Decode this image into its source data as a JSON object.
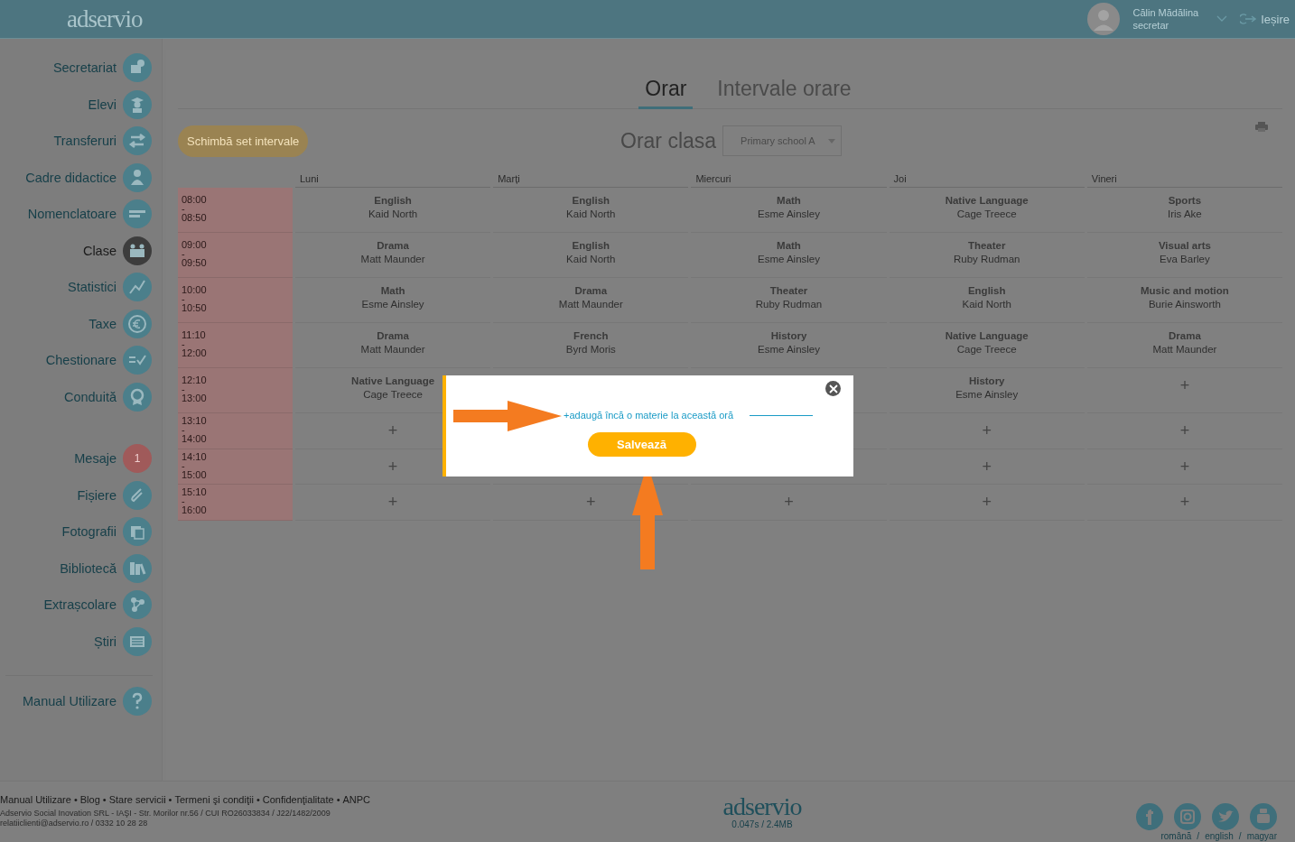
{
  "header": {
    "logo": "adservio",
    "user_name": "Călin Mădălina",
    "user_role": "secretar",
    "logout": "Ieșire"
  },
  "sidebar": {
    "groups": [
      [
        {
          "label": "Secretariat",
          "selected": false
        },
        {
          "label": "Elevi",
          "selected": false
        },
        {
          "label": "Transferuri",
          "selected": false
        },
        {
          "label": "Cadre didactice",
          "selected": false
        },
        {
          "label": "Nomenclatoare",
          "selected": false
        },
        {
          "label": "Clase",
          "selected": true
        },
        {
          "label": "Statistici",
          "selected": false
        },
        {
          "label": "Taxe",
          "selected": false
        },
        {
          "label": "Chestionare",
          "selected": false
        },
        {
          "label": "Conduită",
          "selected": false
        }
      ],
      [
        {
          "label": "Mesaje",
          "selected": false,
          "badge": "1"
        },
        {
          "label": "Fișiere",
          "selected": false
        },
        {
          "label": "Fotografii",
          "selected": false
        },
        {
          "label": "Bibliotecă",
          "selected": false
        },
        {
          "label": "Extrașcolare",
          "selected": false
        },
        {
          "label": "Știri",
          "selected": false
        }
      ],
      [
        {
          "label": "Manual Utilizare",
          "selected": false
        }
      ]
    ]
  },
  "tabs": [
    {
      "label": "Orar",
      "selected": true
    },
    {
      "label": "Intervale orare",
      "selected": false
    }
  ],
  "toolbar": {
    "button": "Schimbă set intervale",
    "title": "Orar clasa",
    "class_select": "Primary school A"
  },
  "timetable": {
    "range_separator": "-",
    "days": [
      "Luni",
      "Marți",
      "Miercuri",
      "Joi",
      "Vineri"
    ],
    "rows": [
      {
        "start": "08:00",
        "end": "08:50",
        "cells": [
          {
            "kind": "lesson",
            "subject": "English",
            "teacher": "Kaid North"
          },
          {
            "kind": "lesson",
            "subject": "English",
            "teacher": "Kaid North"
          },
          {
            "kind": "lesson",
            "subject": "Math",
            "teacher": "Esme Ainsley"
          },
          {
            "kind": "lesson",
            "subject": "Native Language",
            "teacher": "Cage Treece"
          },
          {
            "kind": "lesson",
            "subject": "Sports",
            "teacher": "Iris Ake"
          }
        ]
      },
      {
        "start": "09:00",
        "end": "09:50",
        "cells": [
          {
            "kind": "lesson",
            "subject": "Drama",
            "teacher": "Matt Maunder"
          },
          {
            "kind": "lesson",
            "subject": "English",
            "teacher": "Kaid North"
          },
          {
            "kind": "lesson",
            "subject": "Math",
            "teacher": "Esme Ainsley"
          },
          {
            "kind": "lesson",
            "subject": "Theater",
            "teacher": "Ruby Rudman"
          },
          {
            "kind": "lesson",
            "subject": "Visual arts",
            "teacher": "Eva Barley"
          }
        ]
      },
      {
        "start": "10:00",
        "end": "10:50",
        "cells": [
          {
            "kind": "lesson",
            "subject": "Math",
            "teacher": "Esme Ainsley"
          },
          {
            "kind": "lesson",
            "subject": "Drama",
            "teacher": "Matt Maunder"
          },
          {
            "kind": "lesson",
            "subject": "Theater",
            "teacher": "Ruby Rudman"
          },
          {
            "kind": "lesson",
            "subject": "English",
            "teacher": "Kaid North"
          },
          {
            "kind": "lesson",
            "subject": "Music and motion",
            "teacher": "Burie Ainsworth"
          }
        ]
      },
      {
        "start": "11:10",
        "end": "12:00",
        "cells": [
          {
            "kind": "lesson",
            "subject": "Drama",
            "teacher": "Matt Maunder"
          },
          {
            "kind": "lesson",
            "subject": "French",
            "teacher": "Byrd Moris"
          },
          {
            "kind": "lesson",
            "subject": "History",
            "teacher": "Esme Ainsley"
          },
          {
            "kind": "lesson",
            "subject": "Native Language",
            "teacher": "Cage Treece"
          },
          {
            "kind": "lesson",
            "subject": "Drama",
            "teacher": "Matt Maunder"
          }
        ]
      },
      {
        "start": "12:10",
        "end": "13:00",
        "cells": [
          {
            "kind": "lesson",
            "subject": "Native Language",
            "teacher": "Cage Treece"
          },
          null,
          null,
          {
            "kind": "lesson",
            "subject": "History",
            "teacher": "Esme Ainsley"
          },
          {
            "kind": "empty",
            "add": "+"
          }
        ]
      },
      {
        "start": "13:10",
        "end": "14:00",
        "cells": [
          {
            "kind": "empty",
            "add": "+"
          },
          null,
          null,
          {
            "kind": "empty",
            "add": "+"
          },
          {
            "kind": "empty",
            "add": "+"
          }
        ]
      },
      {
        "start": "14:10",
        "end": "15:00",
        "cells": [
          {
            "kind": "empty",
            "add": "+"
          },
          null,
          null,
          {
            "kind": "empty",
            "add": "+"
          },
          {
            "kind": "empty",
            "add": "+"
          }
        ]
      },
      {
        "start": "15:10",
        "end": "16:00",
        "cells": [
          {
            "kind": "empty",
            "add": "+"
          },
          {
            "kind": "empty",
            "add": "+"
          },
          {
            "kind": "empty",
            "add": "+"
          },
          {
            "kind": "empty",
            "add": "+"
          },
          {
            "kind": "empty",
            "add": "+"
          }
        ]
      }
    ]
  },
  "dialog": {
    "add_link": "+adaugă încă o materie la această oră",
    "save": "Salvează"
  },
  "footer": {
    "links": [
      "Manual Utilizare",
      "Blog",
      "Stare servicii",
      "Termeni şi condiţii",
      "Confidenţialitate",
      "ANPC"
    ],
    "separator": "•",
    "company": "Adservio Social Inovation SRL - IAŞI - Str. Morilor nr.56 / CUI RO26033834 / J22/1482/2009",
    "contact": "relatiiclienti@adservio.ro / 0332 10 28 28",
    "logo": "adservio",
    "stats": "0.047s / 2.4MB",
    "languages": [
      "română",
      "english",
      "magyar"
    ],
    "language_separator": "/"
  }
}
